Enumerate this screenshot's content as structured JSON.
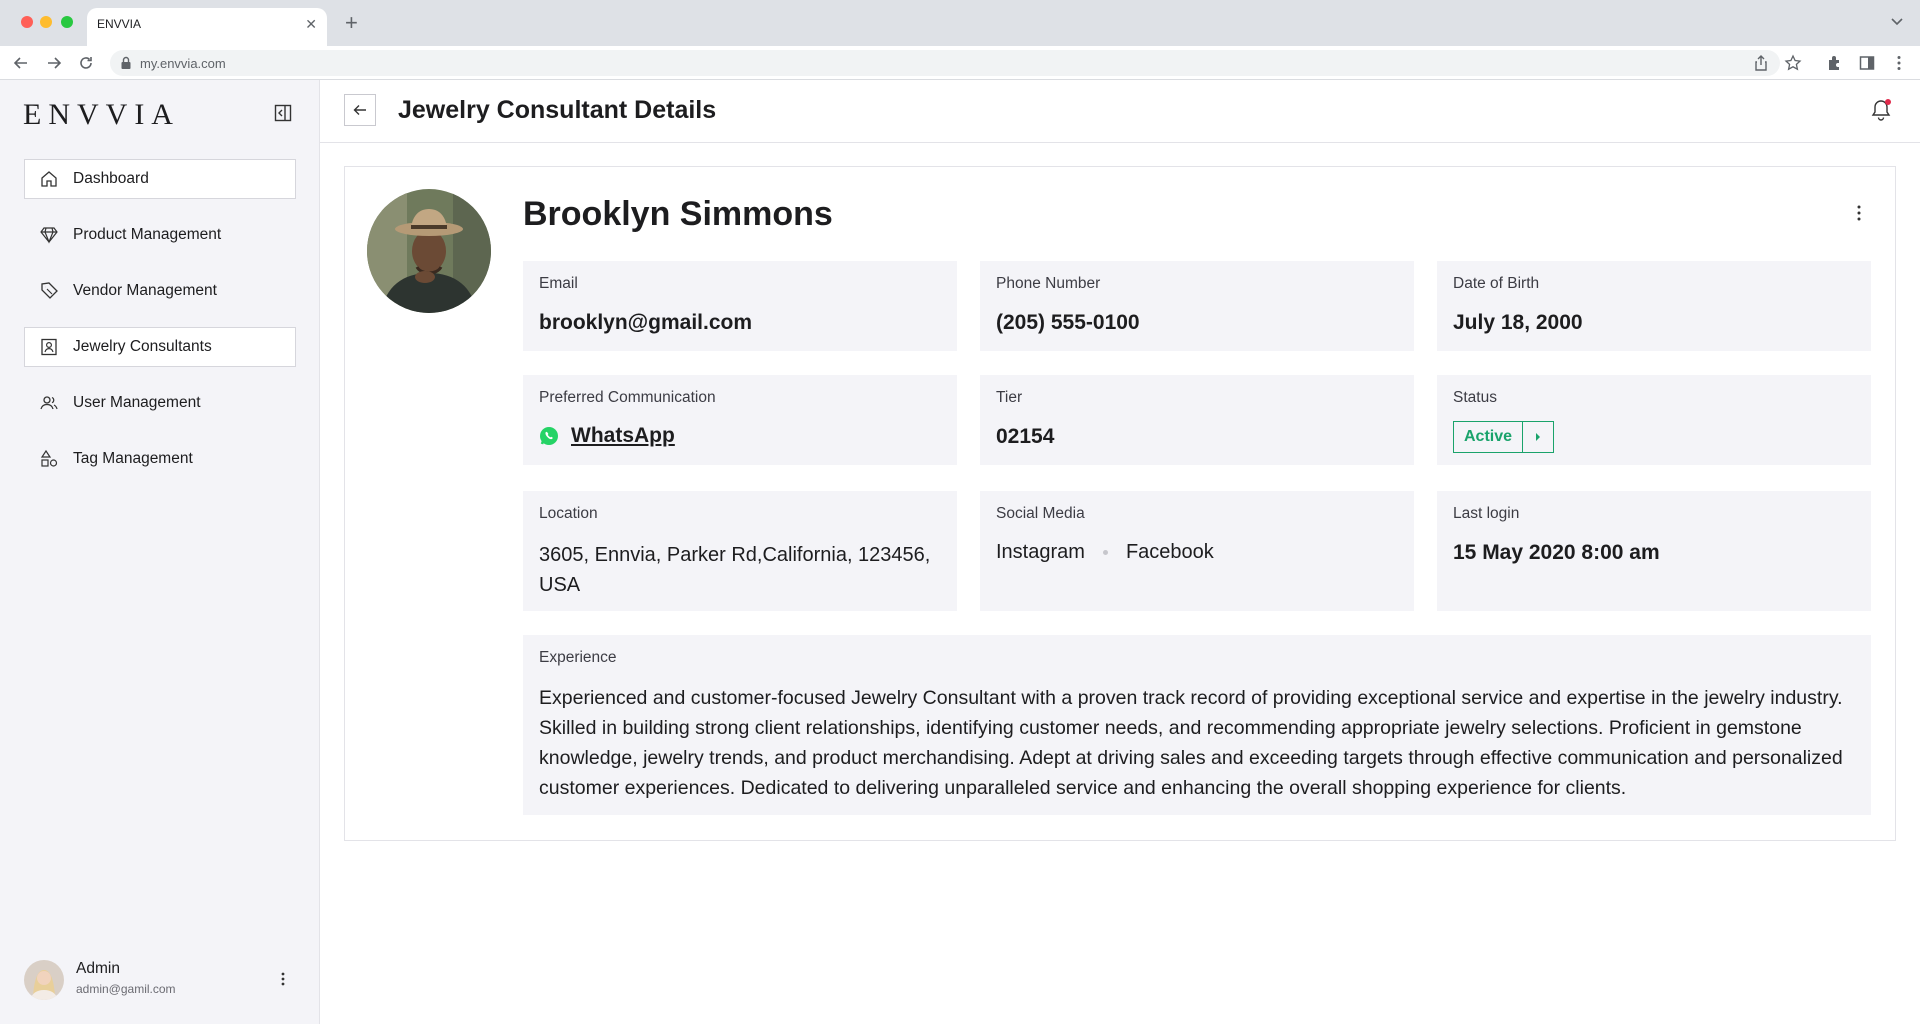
{
  "browser": {
    "tab_title": "ENVVIA",
    "url": "my.envvia.com",
    "icons": [
      "back-arrow-icon",
      "forward-arrow-icon",
      "reload-icon",
      "lock-icon",
      "share-icon",
      "star-icon",
      "puzzle-icon",
      "sidepanel-icon",
      "more-vert-icon"
    ]
  },
  "sidebar": {
    "brand": "ENVVIA",
    "items": [
      {
        "label": "Dashboard",
        "icon": "home-icon",
        "active": true
      },
      {
        "label": "Product Management",
        "icon": "diamond-icon",
        "active": false
      },
      {
        "label": "Vendor Management",
        "icon": "tag-stack-icon",
        "active": false
      },
      {
        "label": "Jewelry Consultants",
        "icon": "contact-card-icon",
        "active": true
      },
      {
        "label": "User Management",
        "icon": "users-icon",
        "active": false
      },
      {
        "label": "Tag Management",
        "icon": "shapes-icon",
        "active": false
      }
    ],
    "profile": {
      "name": "Admin",
      "email": "admin@gamil.com"
    }
  },
  "header": {
    "title": "Jewelry Consultant Details"
  },
  "consultant": {
    "name": "Brooklyn Simmons",
    "email_label": "Email",
    "email": "brooklyn@gmail.com",
    "phone_label": "Phone Number",
    "phone": "(205) 555-0100",
    "dob_label": "Date of Birth",
    "dob": "July 18, 2000",
    "communication_label": "Preferred Communication",
    "communication": "WhatsApp",
    "tier_label": "Tier",
    "tier": "02154",
    "status_label": "Status",
    "status": "Active",
    "location_label": "Location",
    "location": "3605, Ennvia, Parker Rd,California, 123456, USA",
    "social_label": "Social Media",
    "social": [
      "Instagram",
      "Facebook"
    ],
    "last_login_label": "Last login",
    "last_login": "15 May 2020 8:00 am",
    "experience_label": "Experience",
    "experience": "Experienced and customer-focused Jewelry Consultant with a proven track record of providing exceptional service and expertise in the jewelry industry. Skilled in building strong client relationships, identifying customer needs, and recommending appropriate jewelry selections. Proficient in gemstone knowledge, jewelry trends, and product merchandising. Adept at driving sales and exceeding targets through effective communication and personalized customer experiences. Dedicated to delivering unparalleled service and enhancing the overall shopping experience for clients."
  },
  "colors": {
    "accent_green": "#1aa36b",
    "whatsapp_green": "#25d366",
    "notification_dot": "#e0294a",
    "sidebar_bg": "#f4f4f8",
    "field_bg": "#f4f4f8"
  }
}
